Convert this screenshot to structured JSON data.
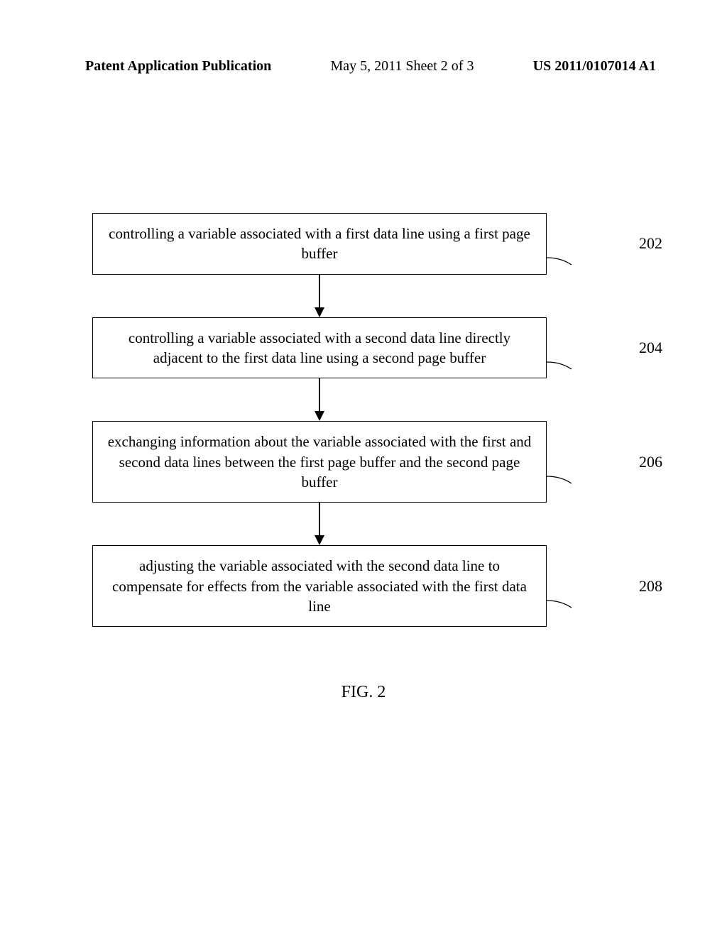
{
  "header": {
    "left": "Patent Application Publication",
    "center": "May 5, 2011   Sheet 2 of 3",
    "right": "US 2011/0107014 A1"
  },
  "steps": [
    {
      "text": "controlling a variable associated with a first data line using a first page buffer",
      "num": "202"
    },
    {
      "text": "controlling a variable associated with a second data line directly adjacent to the first data line using a second page buffer",
      "num": "204"
    },
    {
      "text": "exchanging information about the variable associated with the first and second data lines between the first page buffer and the second page buffer",
      "num": "206"
    },
    {
      "text": "adjusting the variable associated with the second data line to compensate for effects from the variable associated with the first data line",
      "num": "208"
    }
  ],
  "figure_caption": "FIG. 2"
}
